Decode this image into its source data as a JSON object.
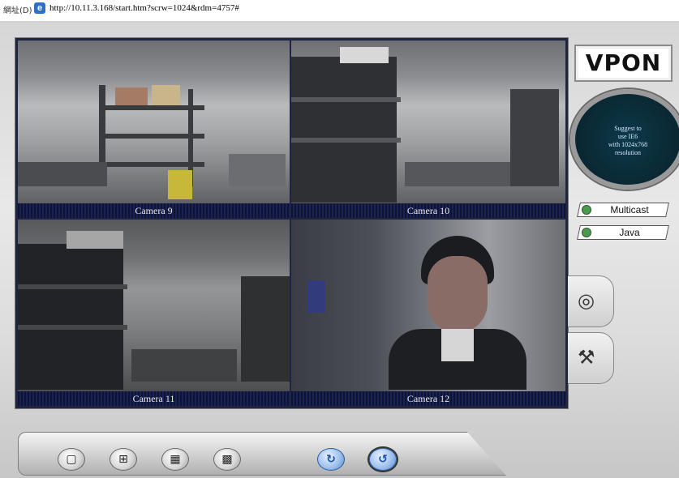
{
  "address_bar": {
    "label": "網址(D)",
    "url": "http://10.11.3.168/start.htm?scrw=1024&rdm=4757#"
  },
  "cameras": [
    {
      "name": "Camera 9"
    },
    {
      "name": "Camera 10"
    },
    {
      "name": "Camera 11"
    },
    {
      "name": "Camera 12"
    }
  ],
  "brand": {
    "logo_text": "VPON"
  },
  "notice": {
    "text_lines": [
      "Suggest to",
      "use IE6",
      "with 1024x768",
      "resolution"
    ]
  },
  "options": [
    {
      "label": "Multicast"
    },
    {
      "label": "Java"
    }
  ],
  "side_tabs": [
    {
      "icon": "disc-settings-icon"
    },
    {
      "icon": "tools-icon"
    }
  ],
  "toolbar": {
    "buttons": [
      {
        "icon": "layout-1-icon"
      },
      {
        "icon": "layout-4-icon"
      },
      {
        "icon": "layout-9-icon"
      },
      {
        "icon": "layout-16-icon"
      },
      {
        "icon": "refresh-icon"
      },
      {
        "icon": "sequence-icon"
      }
    ]
  }
}
